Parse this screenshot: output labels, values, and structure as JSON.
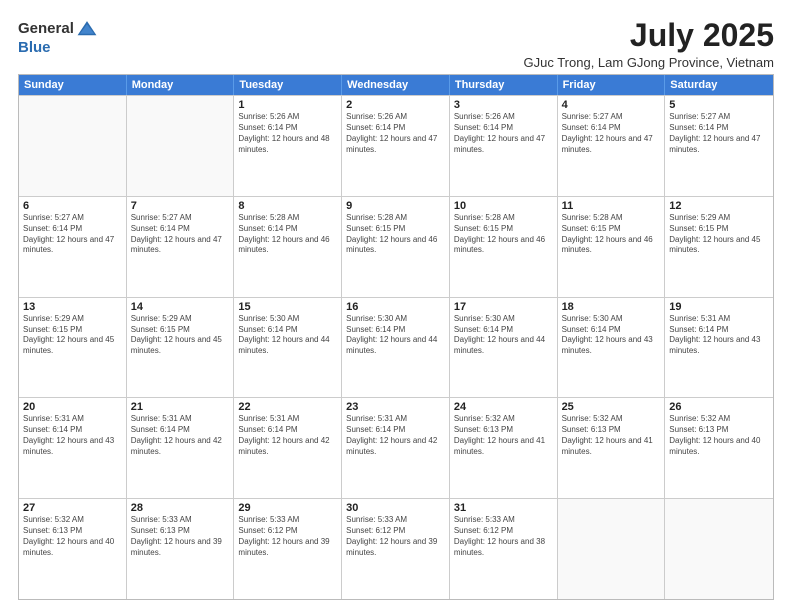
{
  "logo": {
    "general": "General",
    "blue": "Blue"
  },
  "title": "July 2025",
  "subtitle": "GJuc Trong, Lam GJong Province, Vietnam",
  "header_days": [
    "Sunday",
    "Monday",
    "Tuesday",
    "Wednesday",
    "Thursday",
    "Friday",
    "Saturday"
  ],
  "weeks": [
    [
      {
        "day": "",
        "info": ""
      },
      {
        "day": "",
        "info": ""
      },
      {
        "day": "1",
        "info": "Sunrise: 5:26 AM\nSunset: 6:14 PM\nDaylight: 12 hours and 48 minutes."
      },
      {
        "day": "2",
        "info": "Sunrise: 5:26 AM\nSunset: 6:14 PM\nDaylight: 12 hours and 47 minutes."
      },
      {
        "day": "3",
        "info": "Sunrise: 5:26 AM\nSunset: 6:14 PM\nDaylight: 12 hours and 47 minutes."
      },
      {
        "day": "4",
        "info": "Sunrise: 5:27 AM\nSunset: 6:14 PM\nDaylight: 12 hours and 47 minutes."
      },
      {
        "day": "5",
        "info": "Sunrise: 5:27 AM\nSunset: 6:14 PM\nDaylight: 12 hours and 47 minutes."
      }
    ],
    [
      {
        "day": "6",
        "info": "Sunrise: 5:27 AM\nSunset: 6:14 PM\nDaylight: 12 hours and 47 minutes."
      },
      {
        "day": "7",
        "info": "Sunrise: 5:27 AM\nSunset: 6:14 PM\nDaylight: 12 hours and 47 minutes."
      },
      {
        "day": "8",
        "info": "Sunrise: 5:28 AM\nSunset: 6:14 PM\nDaylight: 12 hours and 46 minutes."
      },
      {
        "day": "9",
        "info": "Sunrise: 5:28 AM\nSunset: 6:15 PM\nDaylight: 12 hours and 46 minutes."
      },
      {
        "day": "10",
        "info": "Sunrise: 5:28 AM\nSunset: 6:15 PM\nDaylight: 12 hours and 46 minutes."
      },
      {
        "day": "11",
        "info": "Sunrise: 5:28 AM\nSunset: 6:15 PM\nDaylight: 12 hours and 46 minutes."
      },
      {
        "day": "12",
        "info": "Sunrise: 5:29 AM\nSunset: 6:15 PM\nDaylight: 12 hours and 45 minutes."
      }
    ],
    [
      {
        "day": "13",
        "info": "Sunrise: 5:29 AM\nSunset: 6:15 PM\nDaylight: 12 hours and 45 minutes."
      },
      {
        "day": "14",
        "info": "Sunrise: 5:29 AM\nSunset: 6:15 PM\nDaylight: 12 hours and 45 minutes."
      },
      {
        "day": "15",
        "info": "Sunrise: 5:30 AM\nSunset: 6:14 PM\nDaylight: 12 hours and 44 minutes."
      },
      {
        "day": "16",
        "info": "Sunrise: 5:30 AM\nSunset: 6:14 PM\nDaylight: 12 hours and 44 minutes."
      },
      {
        "day": "17",
        "info": "Sunrise: 5:30 AM\nSunset: 6:14 PM\nDaylight: 12 hours and 44 minutes."
      },
      {
        "day": "18",
        "info": "Sunrise: 5:30 AM\nSunset: 6:14 PM\nDaylight: 12 hours and 43 minutes."
      },
      {
        "day": "19",
        "info": "Sunrise: 5:31 AM\nSunset: 6:14 PM\nDaylight: 12 hours and 43 minutes."
      }
    ],
    [
      {
        "day": "20",
        "info": "Sunrise: 5:31 AM\nSunset: 6:14 PM\nDaylight: 12 hours and 43 minutes."
      },
      {
        "day": "21",
        "info": "Sunrise: 5:31 AM\nSunset: 6:14 PM\nDaylight: 12 hours and 42 minutes."
      },
      {
        "day": "22",
        "info": "Sunrise: 5:31 AM\nSunset: 6:14 PM\nDaylight: 12 hours and 42 minutes."
      },
      {
        "day": "23",
        "info": "Sunrise: 5:31 AM\nSunset: 6:14 PM\nDaylight: 12 hours and 42 minutes."
      },
      {
        "day": "24",
        "info": "Sunrise: 5:32 AM\nSunset: 6:13 PM\nDaylight: 12 hours and 41 minutes."
      },
      {
        "day": "25",
        "info": "Sunrise: 5:32 AM\nSunset: 6:13 PM\nDaylight: 12 hours and 41 minutes."
      },
      {
        "day": "26",
        "info": "Sunrise: 5:32 AM\nSunset: 6:13 PM\nDaylight: 12 hours and 40 minutes."
      }
    ],
    [
      {
        "day": "27",
        "info": "Sunrise: 5:32 AM\nSunset: 6:13 PM\nDaylight: 12 hours and 40 minutes."
      },
      {
        "day": "28",
        "info": "Sunrise: 5:33 AM\nSunset: 6:13 PM\nDaylight: 12 hours and 39 minutes."
      },
      {
        "day": "29",
        "info": "Sunrise: 5:33 AM\nSunset: 6:12 PM\nDaylight: 12 hours and 39 minutes."
      },
      {
        "day": "30",
        "info": "Sunrise: 5:33 AM\nSunset: 6:12 PM\nDaylight: 12 hours and 39 minutes."
      },
      {
        "day": "31",
        "info": "Sunrise: 5:33 AM\nSunset: 6:12 PM\nDaylight: 12 hours and 38 minutes."
      },
      {
        "day": "",
        "info": ""
      },
      {
        "day": "",
        "info": ""
      }
    ]
  ]
}
